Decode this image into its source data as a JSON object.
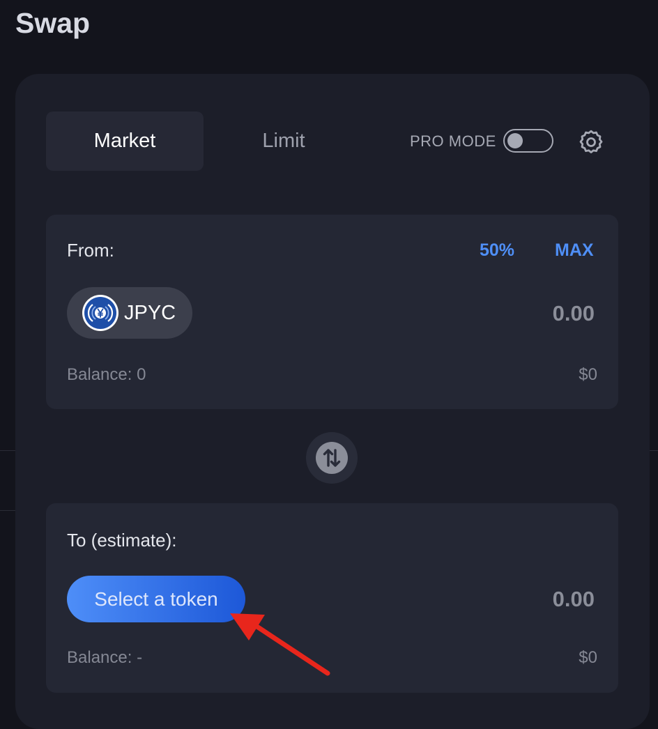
{
  "page_title": "Swap",
  "tabs": [
    {
      "label": "Market",
      "active": true
    },
    {
      "label": "Limit",
      "active": false
    }
  ],
  "pro_mode": {
    "label": "PRO MODE",
    "enabled": false
  },
  "settings_icon": "gear-icon",
  "from": {
    "label": "From:",
    "quick_buttons": [
      "50%",
      "MAX"
    ],
    "token": {
      "symbol": "JPYC",
      "icon": "yen-coin-icon"
    },
    "amount": "0.00",
    "balance": "Balance: 0",
    "usd_value": "$0"
  },
  "switch_icon": "swap-arrows-icon",
  "to": {
    "label": "To (estimate):",
    "select_token_label": "Select a token",
    "amount": "0.00",
    "balance": "Balance: -",
    "usd_value": "$0"
  },
  "colors": {
    "accent": "#4f8ff7",
    "card_background": "#1c1e29",
    "panel_background": "#242734",
    "annotation_arrow": "#e8261c"
  }
}
